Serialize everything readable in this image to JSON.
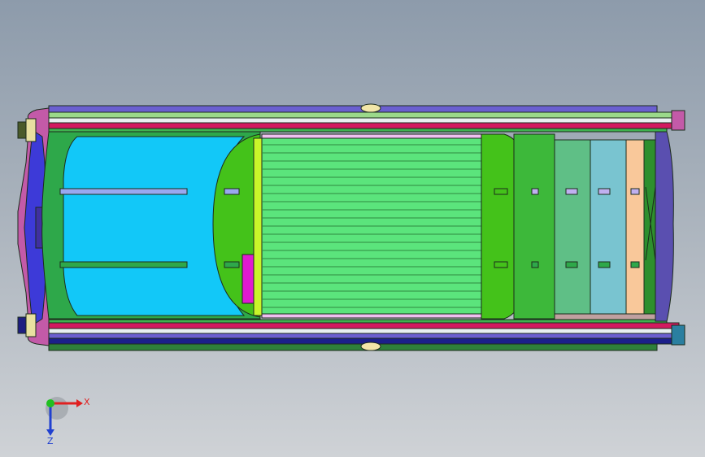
{
  "viewport": {
    "background_top": "#8d9bab",
    "background_bottom": "#cfd2d6"
  },
  "model": {
    "name": "car-top-view",
    "colors": {
      "outline": "#1c2b1c",
      "roof_green": "#44c21a",
      "roof_panel": "#5be47c",
      "windshield_blue": "#12c8f8",
      "body_green": "#2ea84a",
      "bed_green": "#5fbf86",
      "bed_teal": "#79c4d0",
      "bed_peach": "#f9c89a",
      "rail_magenta": "#d2195f",
      "rail_purple": "#6b5fd0",
      "rail_navy": "#1b1f8a",
      "bumper_pink": "#c35aa8",
      "mirror_yellow": "#f2e6a8",
      "lime": "#c8f52a",
      "handle_magenta": "#e01ad0"
    }
  },
  "triad": {
    "x_label": "X",
    "z_label": "Z",
    "x_color": "#e02020",
    "y_color": "#20c020",
    "z_color": "#2040d0"
  }
}
